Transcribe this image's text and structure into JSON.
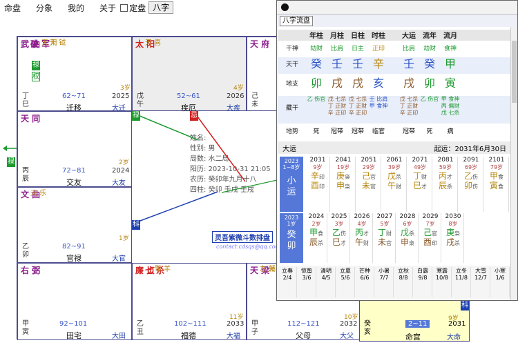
{
  "menu": {
    "items": [
      "命盘",
      "分象",
      "我的",
      "关于"
    ],
    "checkbox_label": "定盘",
    "tab_button": "八字"
  },
  "cells": {
    "c1": {
      "stars": [
        "武\n曲",
        "破\n军"
      ],
      "minor": [
        "天\n刑",
        "天\n钺"
      ],
      "gz": "丁\n巳",
      "range": "62~71",
      "name": "迁移",
      "year": "2025",
      "lim": "大迁",
      "age": "3岁",
      "tag1": "禄",
      "tag2": "权"
    },
    "c2": {
      "stars": [
        "太\n阳"
      ],
      "minor": [
        "天\n喜"
      ],
      "gz": "戊\n午",
      "range": "52~61",
      "name": "疾厄",
      "year": "2026",
      "lim": "大疾",
      "age": "4岁"
    },
    "c3": {
      "stars": [
        "天\n府"
      ],
      "gz": "己\n未"
    },
    "c4": {
      "stars": [
        "天\n同"
      ],
      "gz": "丙\n辰",
      "range": "72~81",
      "name": "交友",
      "year": "2024",
      "lim": "大友",
      "age": "2岁"
    },
    "c5": {
      "stars": [
        "文\n曲"
      ],
      "minor": [
        "天\n乐"
      ],
      "gz": "乙\n卯",
      "range": "82~91",
      "name": "官禄",
      "lim": "大官",
      "age": "1岁"
    },
    "c6": {
      "stars": [
        "右\n弼"
      ],
      "gz": "甲\n寅",
      "range": "92~101",
      "name": "田宅",
      "lim": "大田"
    },
    "c7": {
      "stars": [
        "廉\n贞",
        "七\n杀"
      ],
      "minor": [
        "擎\n羊"
      ],
      "gz": "乙\n丑",
      "range": "102~111",
      "name": "福德",
      "year": "2033",
      "lim": "大福",
      "age": "11岁"
    },
    "c8": {
      "stars": [
        "天\n梁"
      ],
      "minor": [
        "左\n辅",
        "天\n空"
      ],
      "gz": "甲\n子",
      "range": "112~121",
      "name": "父母",
      "year": "2032",
      "lim": "大父",
      "age": "10岁"
    },
    "c9": {
      "gz": "癸\n亥",
      "range": "2~11",
      "name": "命宫",
      "year": "2031",
      "lim": "大命",
      "age": "9岁"
    }
  },
  "center": {
    "lines": [
      "姓名:",
      "性别: 男",
      "局数: 水二局",
      "阳历: 2023-10-31 21:05",
      "农历: 癸卯年九月十八",
      "四柱: 癸卯 壬戌 壬戌"
    ],
    "stamp": "灵吾紫微斗数排盘",
    "url": "contact:cdsqs@qq.com"
  },
  "bazi": {
    "tab": "八字流盘",
    "headers": [
      "年柱",
      "月柱",
      "日柱",
      "时柱",
      "大运",
      "流年",
      "流月"
    ],
    "labels": {
      "shishen": "干神",
      "tiangan": "天干",
      "dizhi": "地支",
      "canggan": "藏干",
      "dishi": "地势"
    },
    "shishen": [
      "劫财",
      "比肩",
      "日主",
      "正印",
      "比肩",
      "劫财",
      "食神"
    ],
    "tiangan": [
      "癸",
      "壬",
      "壬",
      "辛",
      "壬",
      "癸",
      "甲"
    ],
    "tiangan_colors": [
      "#2b53c9",
      "#2b53c9",
      "#2b53c9",
      "#b8860b",
      "#2b53c9",
      "#2b53c9",
      "#1c9a2e"
    ],
    "dizhi": [
      "卯",
      "戌",
      "戌",
      "亥",
      "戌",
      "卯",
      "寅"
    ],
    "dizhi_colors": [
      "#1c9a2e",
      "#8b5a2b",
      "#8b5a2b",
      "#2b53c9",
      "#8b5a2b",
      "#1c9a2e",
      "#1c9a2e"
    ],
    "canggan": [
      "乙 伤官",
      "戊 七杀\n丁 正财\n辛 正印",
      "戊 七杀\n丁 正财\n辛 正印",
      "壬 比肩\n甲 食神",
      "戊 七杀\n丁 正财\n辛 正印",
      "乙 伤官",
      "甲 食神\n丙 偏财\n戊 七杀"
    ],
    "dishi": [
      "死",
      "冠带",
      "冠带",
      "临官",
      "冠带",
      "死",
      "病"
    ],
    "dayun_title": "大运",
    "qiyun": "起运：2031年6月30日",
    "xiaoyun_label": "小\n运",
    "xiaoyun_years": "2023\n1~8岁",
    "dayun": [
      {
        "year": "2031",
        "age": "9岁",
        "g": "辛",
        "gs": "印",
        "z": "酉",
        "zs": "印"
      },
      {
        "year": "2041",
        "age": "19岁",
        "g": "庚",
        "gs": "枭",
        "z": "申",
        "zs": "枭"
      },
      {
        "year": "2051",
        "age": "29岁",
        "g": "己",
        "gs": "官",
        "z": "未",
        "zs": "官"
      },
      {
        "year": "2061",
        "age": "39岁",
        "g": "戊",
        "gs": "杀",
        "z": "午",
        "zs": "财"
      },
      {
        "year": "2071",
        "age": "49岁",
        "g": "丁",
        "gs": "财",
        "z": "巳",
        "zs": "才"
      },
      {
        "year": "2081",
        "age": "59岁",
        "g": "丙",
        "gs": "才",
        "z": "辰",
        "zs": "杀"
      },
      {
        "year": "2091",
        "age": "69岁",
        "g": "乙",
        "gs": "伤",
        "z": "卯",
        "zs": "伤"
      },
      {
        "year": "2101",
        "age": "79岁",
        "g": "甲",
        "gs": "食",
        "z": "寅",
        "zs": "食"
      }
    ],
    "liunian_head": "2023\n1岁",
    "liunian_g": "癸",
    "liunian_z": "卯",
    "liunian": [
      {
        "year": "2024",
        "age": "2岁",
        "g": "甲",
        "gs": "食",
        "z": "辰",
        "zs": "杀"
      },
      {
        "year": "2025",
        "age": "3岁",
        "g": "乙",
        "gs": "伤",
        "z": "巳",
        "zs": "才"
      },
      {
        "year": "2026",
        "age": "4岁",
        "g": "丙",
        "gs": "才",
        "z": "午",
        "zs": "财"
      },
      {
        "year": "2027",
        "age": "5岁",
        "g": "丁",
        "gs": "财",
        "z": "未",
        "zs": "官"
      },
      {
        "year": "2028",
        "age": "6岁",
        "g": "戊",
        "gs": "杀",
        "z": "申",
        "zs": "枭"
      },
      {
        "year": "2029",
        "age": "7岁",
        "g": "己",
        "gs": "官",
        "z": "酉",
        "zs": "印"
      },
      {
        "year": "2030",
        "age": "8岁",
        "g": "庚",
        "gs": "枭",
        "z": "戌",
        "zs": "杀"
      }
    ],
    "jieqi": [
      {
        "name": "立春",
        "date": "2/4"
      },
      {
        "name": "惊蛰",
        "date": "3/6"
      },
      {
        "name": "清明",
        "date": "4/5"
      },
      {
        "name": "立夏",
        "date": "5/6"
      },
      {
        "name": "芒种",
        "date": "6/6"
      },
      {
        "name": "小暑",
        "date": "7/7"
      },
      {
        "name": "立秋",
        "date": "8/8"
      },
      {
        "name": "白露",
        "date": "9/8"
      },
      {
        "name": "寒露",
        "date": "10/8"
      },
      {
        "name": "立冬",
        "date": "11/8"
      },
      {
        "name": "大雪",
        "date": "12/7"
      },
      {
        "name": "小寒",
        "date": "1/6"
      }
    ]
  },
  "colors": {
    "grid": "#4b4b8f",
    "blue_text": "#2b53c9",
    "green_tag": "#1c9a2e",
    "red_tag": "#d22020",
    "highlight": "#ffffc8",
    "dayun_bg": "#5578d8"
  }
}
